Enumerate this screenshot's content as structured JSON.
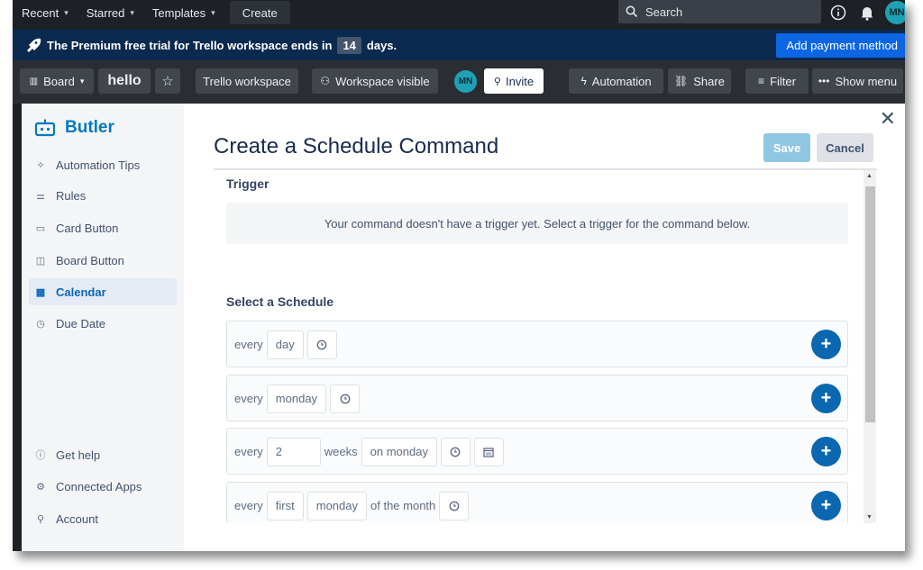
{
  "topnav": {
    "items": [
      {
        "label": "Recent"
      },
      {
        "label": "Starred"
      },
      {
        "label": "Templates"
      }
    ],
    "create_label": "Create",
    "search_placeholder": "Search",
    "avatar_initials": "MN"
  },
  "banner": {
    "text_before": "The Premium free trial for Trello workspace ends in",
    "days": "14",
    "text_after": "days.",
    "payment_label": "Add payment method"
  },
  "board": {
    "view_label": "Board",
    "title": "hello",
    "workspace_label": "Trello workspace",
    "visibility_label": "Workspace visible",
    "member_initials": "MN",
    "invite_label": "Invite",
    "automation_label": "Automation",
    "share_label": "Share",
    "filter_label": "Filter",
    "show_menu_label": "Show menu"
  },
  "butler": {
    "title": "Butler",
    "nav": [
      {
        "label": "Automation Tips",
        "icon": "sparkle-icon"
      },
      {
        "label": "Rules",
        "icon": "sliders-icon"
      },
      {
        "label": "Card Button",
        "icon": "card-icon"
      },
      {
        "label": "Board Button",
        "icon": "board-icon"
      },
      {
        "label": "Calendar",
        "icon": "calendar-icon",
        "active": true
      },
      {
        "label": "Due Date",
        "icon": "clock-icon"
      }
    ],
    "footer_nav": [
      {
        "label": "Get help",
        "icon": "info-icon"
      },
      {
        "label": "Connected Apps",
        "icon": "gear-icon"
      },
      {
        "label": "Account",
        "icon": "person-icon"
      }
    ]
  },
  "command": {
    "title": "Create a Schedule Command",
    "save_label": "Save",
    "cancel_label": "Cancel",
    "trigger_heading": "Trigger",
    "trigger_empty": "Your command doesn't have a trigger yet. Select a trigger for the command below.",
    "schedule_heading": "Select a Schedule",
    "schedules": [
      {
        "every": "every",
        "value": "day"
      },
      {
        "every": "every",
        "value": "monday"
      },
      {
        "every": "every",
        "number": "2",
        "unit": "weeks",
        "value": "on monday"
      },
      {
        "every": "every",
        "ordinal": "first",
        "value": "monday",
        "suffix": "of the month"
      }
    ]
  },
  "colors": {
    "accent": "#0079bf",
    "banner_bg": "#0a2a4f",
    "payment_btn": "#0c66e4",
    "plus_btn": "#0a67b0"
  }
}
